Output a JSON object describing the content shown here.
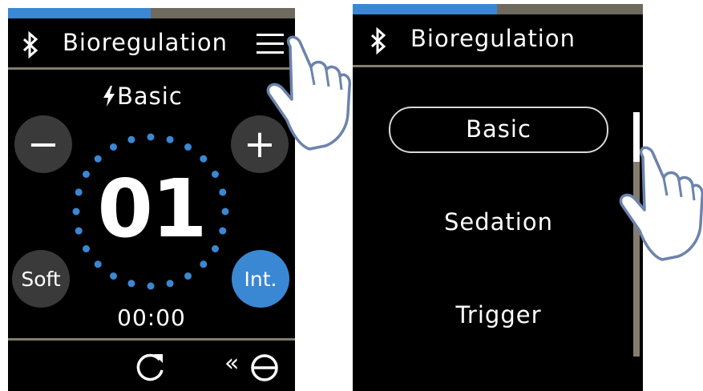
{
  "progress": {
    "fraction": 0.5
  },
  "colors": {
    "accent": "#3a88d4",
    "divider": "#857d6c",
    "button": "#3a3a3a",
    "hand": "#6c83ad"
  },
  "left_screen": {
    "header": {
      "title": "Bioregulation",
      "bluetooth_icon": "bluetooth-icon",
      "menu_icon": "menu-icon"
    },
    "mode_label": "Basic",
    "mode_icon": "lightning-icon",
    "minus_label": "−",
    "plus_label": "+",
    "level": "01",
    "soft_label": "Soft",
    "int_label": "Int.",
    "timer": "00:00",
    "footer": {
      "refresh_icon": "refresh-icon",
      "back_label": "«",
      "exit_icon": "circle-exit-icon"
    }
  },
  "right_screen": {
    "header": {
      "title": "Bioregulation",
      "bluetooth_icon": "bluetooth-icon"
    },
    "options": [
      "Basic",
      "Sedation",
      "Trigger"
    ],
    "selected": "Basic"
  }
}
